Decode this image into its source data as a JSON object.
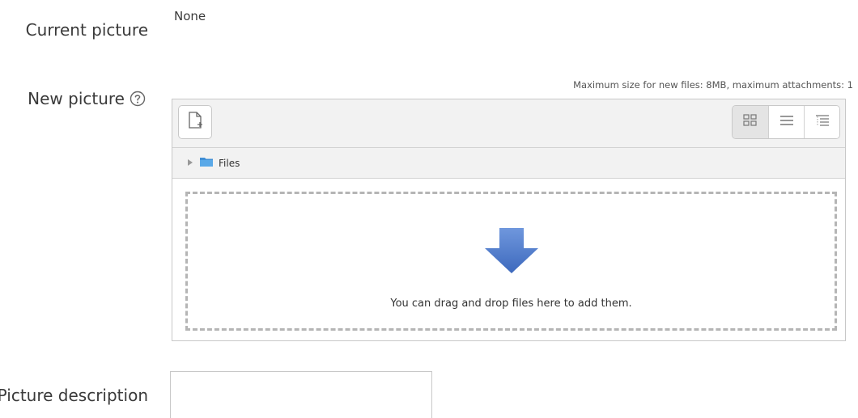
{
  "current_picture": {
    "label": "Current picture",
    "value": "None"
  },
  "new_picture": {
    "label": "New picture",
    "help_icon": "help-circle-icon",
    "max_note": "Maximum size for new files: 8MB, maximum attachments: 1",
    "toolbar": {
      "add_icon": "add-file-icon",
      "views": [
        "grid-view-icon",
        "list-view-icon",
        "tree-view-icon"
      ]
    },
    "path": {
      "folder_label": "Files"
    },
    "dropzone": {
      "text": "You can drag and drop files here to add them.",
      "arrow_color": "#4b77c8"
    }
  },
  "picture_description": {
    "label": "Picture description",
    "value": ""
  }
}
